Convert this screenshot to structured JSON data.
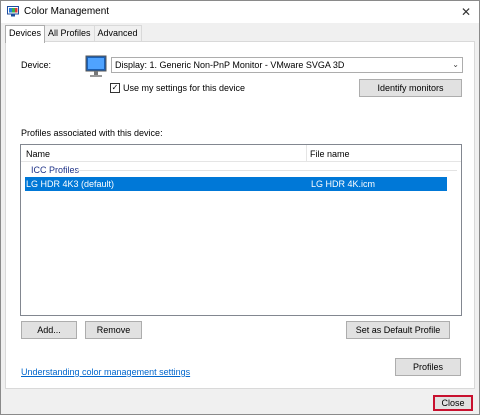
{
  "window": {
    "title": "Color Management"
  },
  "tabs": [
    {
      "label": "Devices",
      "active": true
    },
    {
      "label": "All Profiles",
      "active": false
    },
    {
      "label": "Advanced",
      "active": false
    }
  ],
  "device": {
    "label": "Device:",
    "selected": "Display: 1. Generic Non-PnP Monitor - VMware SVGA 3D",
    "use_settings_label": "Use my settings for this device",
    "use_settings_checked": "☑",
    "identify_button": "Identify monitors"
  },
  "profiles": {
    "section_label": "Profiles associated with this device:",
    "columns": [
      "Name",
      "File name"
    ],
    "group": "ICC Profiles",
    "rows": [
      {
        "name": "LG HDR 4K3 (default)",
        "file": "LG HDR 4K.icm",
        "selected": true
      }
    ]
  },
  "buttons": {
    "add": "Add...",
    "remove": "Remove",
    "set_default": "Set as Default Profile",
    "profiles": "Profiles",
    "close": "Close"
  },
  "link": {
    "text": "Understanding color management settings"
  },
  "colors": {
    "accent": "#0078d7",
    "highlight_border": "#c8102e",
    "link": "#0066cc"
  }
}
